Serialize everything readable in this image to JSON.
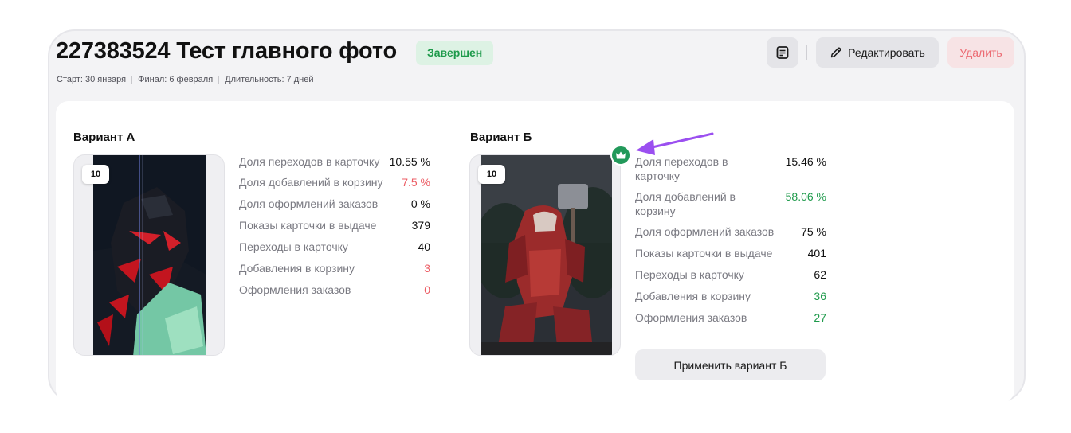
{
  "header": {
    "title": "227383524 Тест главного фото",
    "status": "Завершен",
    "start": "Старт: 30 января",
    "finish": "Финал: 6 февраля",
    "duration": "Длительность: 7 дней",
    "edit_label": "Редактировать",
    "delete_label": "Удалить",
    "icons": {
      "notes": "notes-icon",
      "edit": "pencil-icon"
    }
  },
  "variant_a": {
    "title": "Вариант А",
    "image_badge": "10",
    "stats": [
      {
        "label": "Доля переходов в карточку",
        "value": "10.55 %",
        "tone": "neutral"
      },
      {
        "label": "Доля добавлений в корзину",
        "value": "7.5 %",
        "tone": "red"
      },
      {
        "label": "Доля оформлений заказов",
        "value": "0 %",
        "tone": "neutral"
      },
      {
        "label": "Показы карточки в выдаче",
        "value": "379",
        "tone": "neutral"
      },
      {
        "label": "Переходы в карточку",
        "value": "40",
        "tone": "neutral"
      },
      {
        "label": "Добавления в корзину",
        "value": "3",
        "tone": "red"
      },
      {
        "label": "Оформления заказов",
        "value": "0",
        "tone": "red"
      }
    ]
  },
  "variant_b": {
    "title": "Вариант Б",
    "image_badge": "10",
    "winner_icon": "crown-icon",
    "stats": [
      {
        "label": "Доля переходов в карточку",
        "value": "15.46 %",
        "tone": "neutral"
      },
      {
        "label": "Доля добавлений в корзину",
        "value": "58.06 %",
        "tone": "green"
      },
      {
        "label": "Доля оформлений заказов",
        "value": "75 %",
        "tone": "neutral"
      },
      {
        "label": "Показы карточки в выдаче",
        "value": "401",
        "tone": "neutral"
      },
      {
        "label": "Переходы в карточку",
        "value": "62",
        "tone": "neutral"
      },
      {
        "label": "Добавления в корзину",
        "value": "36",
        "tone": "green"
      },
      {
        "label": "Оформления заказов",
        "value": "27",
        "tone": "green"
      }
    ],
    "apply_label": "Применить вариант Б"
  },
  "colors": {
    "green": "#1e9a4b",
    "red": "#ec5c64",
    "arrow": "#9b4ff0"
  }
}
